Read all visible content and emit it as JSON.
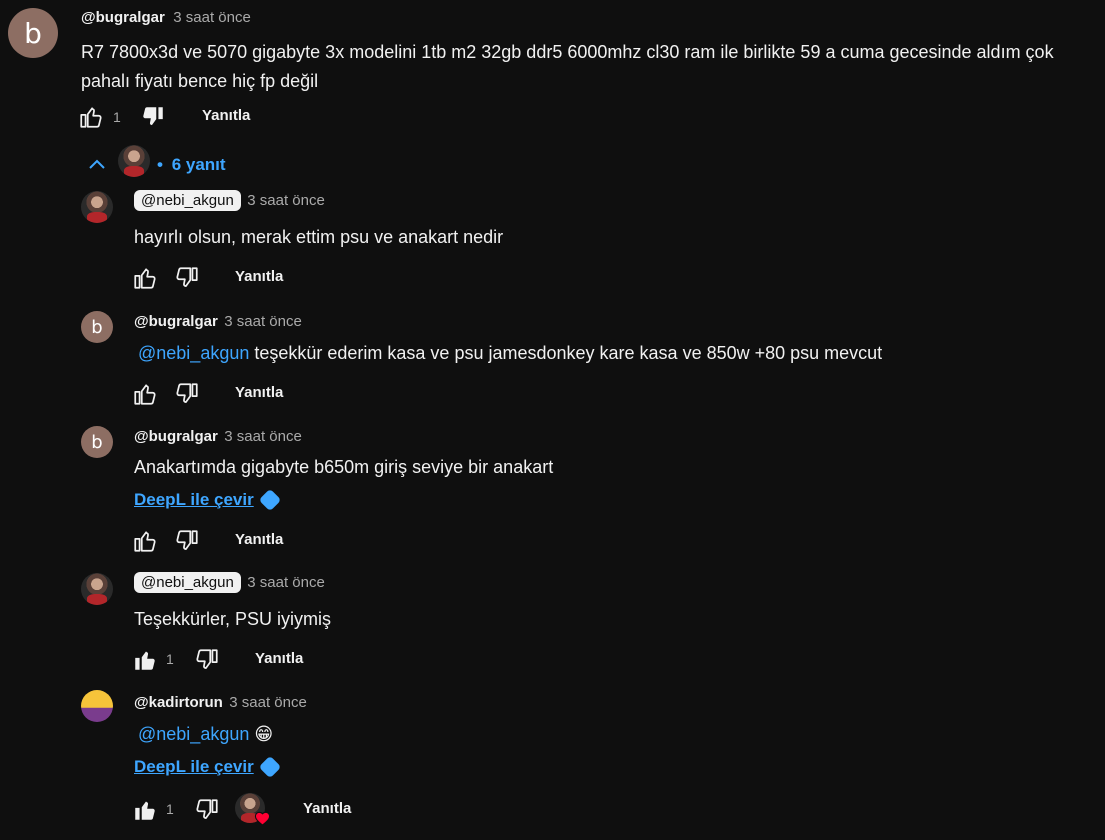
{
  "main_comment": {
    "avatar_letter": "b",
    "handle": "@bugralgar",
    "time": "3 saat önce",
    "text_line1": "R7 7800x3d ve 5070 gigabyte 3x modelini 1tb m2 32gb ddr5 6000mhz cl30 ram ile birlikte 59 a cuma gecesinde aldım çok",
    "text_line2": "pahalı fiyatı bence hiç fp değil",
    "like_count": "1",
    "reply_label": "Yanıtla"
  },
  "replies_toggle": {
    "dot": "•",
    "label": "6 yanıt"
  },
  "replies": [
    {
      "handle": "@nebi_akgun",
      "time": "3 saat önce",
      "text": "hayırlı olsun, merak ettim psu ve anakart nedir",
      "reply_label": "Yanıtla"
    },
    {
      "avatar_letter": "b",
      "handle": "@bugralgar",
      "time": "3 saat önce",
      "mention": "@nebi_akgun",
      "text": " teşekkür ederim kasa ve psu jamesdonkey kare kasa ve 850w +80 psu mevcut",
      "reply_label": "Yanıtla"
    },
    {
      "avatar_letter": "b",
      "handle": "@bugralgar",
      "time": "3 saat önce",
      "text": "Anakartımda gigabyte b650m giriş seviye bir anakart",
      "translate": "DeepL ile çevir",
      "reply_label": "Yanıtla"
    },
    {
      "handle": "@nebi_akgun",
      "time": "3 saat önce",
      "text": "Teşekkürler, PSU iyiymiş",
      "like_count": "1",
      "reply_label": "Yanıtla"
    },
    {
      "handle": "@kadirtorun",
      "time": "3 saat önce",
      "mention": "@nebi_akgun",
      "emoji": "😁",
      "translate": "DeepL ile çevir",
      "like_count": "1",
      "reply_label": "Yanıtla"
    }
  ],
  "icons": {
    "like": "thumbs-up-icon",
    "like_filled": "thumbs-up-filled-icon",
    "dislike": "thumbs-down-icon",
    "dislike_filled": "thumbs-down-filled-icon",
    "collapse": "chevron-up-icon",
    "translate": "deepl-icon",
    "heart": "heart-icon"
  },
  "colors": {
    "background": "#0f0f0f",
    "text": "#f1f1f1",
    "muted": "#aaaaaa",
    "link": "#3ea6ff",
    "heart": "#ff0033",
    "avatar_b": "#8d6e63"
  }
}
